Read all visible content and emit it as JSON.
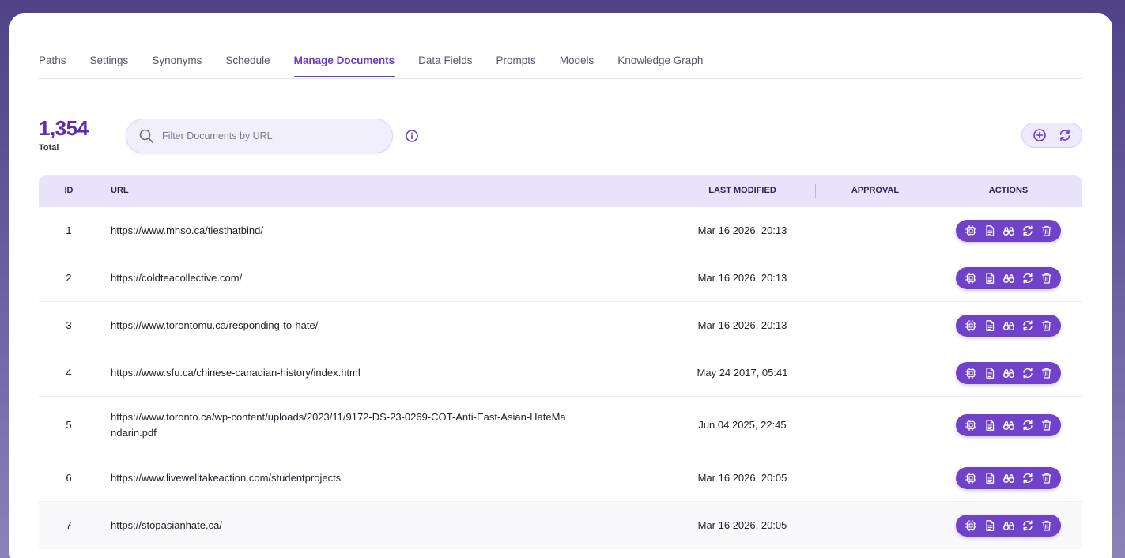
{
  "tabs": [
    {
      "label": "Paths",
      "active": false
    },
    {
      "label": "Settings",
      "active": false
    },
    {
      "label": "Synonyms",
      "active": false
    },
    {
      "label": "Schedule",
      "active": false
    },
    {
      "label": "Manage Documents",
      "active": true
    },
    {
      "label": "Data Fields",
      "active": false
    },
    {
      "label": "Prompts",
      "active": false
    },
    {
      "label": "Models",
      "active": false
    },
    {
      "label": "Knowledge Graph",
      "active": false
    }
  ],
  "summary": {
    "total_value": "1,354",
    "total_label": "Total"
  },
  "search": {
    "value": "",
    "placeholder": "Filter Documents by URL"
  },
  "table": {
    "headers": {
      "id": "ID",
      "url": "URL",
      "last_modified": "LAST MODIFIED",
      "approval": "APPROVAL",
      "actions": "ACTIONS"
    },
    "rows": [
      {
        "id": "1",
        "url": "https://www.mhso.ca/tiesthatbind/",
        "last_modified": "Mar 16 2026, 20:13",
        "approval": ""
      },
      {
        "id": "2",
        "url": "https://coldteacollective.com/",
        "last_modified": "Mar 16 2026, 20:13",
        "approval": ""
      },
      {
        "id": "3",
        "url": "https://www.torontomu.ca/responding-to-hate/",
        "last_modified": "Mar 16 2026, 20:13",
        "approval": ""
      },
      {
        "id": "4",
        "url": "https://www.sfu.ca/chinese-canadian-history/index.html",
        "last_modified": "May 24 2017, 05:41",
        "approval": ""
      },
      {
        "id": "5",
        "url": "https://www.toronto.ca/wp-content/uploads/2023/11/9172-DS-23-0269-COT-Anti-East-Asian-HateMandarin.pdf",
        "last_modified": "Jun 04 2025, 22:45",
        "approval": ""
      },
      {
        "id": "6",
        "url": "https://www.livewelltakeaction.com/studentprojects",
        "last_modified": "Mar 16 2026, 20:05",
        "approval": ""
      },
      {
        "id": "7",
        "url": "https://stopasianhate.ca/",
        "last_modified": "Mar 16 2026, 20:05",
        "approval": ""
      }
    ],
    "row_actions": [
      "cpu-icon",
      "document-icon",
      "binoculars-icon",
      "refresh-icon",
      "trash-icon"
    ]
  },
  "toolbar_icons": [
    "add-circle-icon",
    "refresh-icon"
  ],
  "colors": {
    "accent": "#6a3bc4",
    "action_pill": "#6f42c9",
    "header_bg": "#e8e3fb",
    "background": "#4f4287"
  }
}
